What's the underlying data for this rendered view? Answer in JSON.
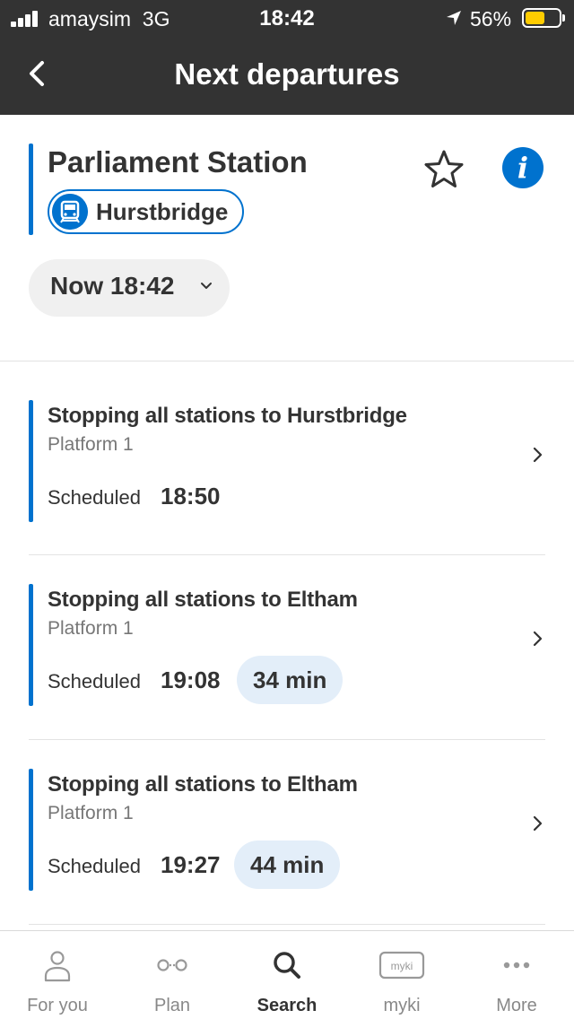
{
  "status_bar": {
    "carrier": "amaysim",
    "network": "3G",
    "time": "18:42",
    "battery": "56%",
    "battery_level": 0.56
  },
  "nav": {
    "title": "Next departures",
    "back_icon": "chevron-left-icon"
  },
  "station": {
    "name": "Parliament Station",
    "route": "Hurstbridge",
    "route_icon": "train-icon",
    "favorite_icon": "star-outline-icon",
    "info_icon": "info-icon",
    "info_glyph": "i"
  },
  "time_selector": {
    "label": "Now 18:42",
    "icon": "chevron-down-icon"
  },
  "departures": [
    {
      "destination": "Stopping all stations to Hurstbridge",
      "platform": "Platform 1",
      "scheduled_label": "Scheduled",
      "time": "18:50",
      "minutes": ""
    },
    {
      "destination": "Stopping all stations to Eltham",
      "platform": "Platform 1",
      "scheduled_label": "Scheduled",
      "time": "19:08",
      "minutes": "34 min"
    },
    {
      "destination": "Stopping all stations to Eltham",
      "platform": "Platform 1",
      "scheduled_label": "Scheduled",
      "time": "19:27",
      "minutes": "44 min"
    }
  ],
  "tabs": [
    {
      "label": "For you",
      "icon": "person-icon",
      "active": false
    },
    {
      "label": "Plan",
      "icon": "route-icon",
      "active": false
    },
    {
      "label": "Search",
      "icon": "search-icon",
      "active": true
    },
    {
      "label": "myki",
      "icon": "myki-card-icon",
      "icon_text": "myki",
      "active": false
    },
    {
      "label": "More",
      "icon": "more-icon",
      "active": false
    }
  ],
  "colors": {
    "header_bg": "#333333",
    "accent": "#0072ce",
    "battery_fill": "#ffcc00",
    "minutes_badge_bg": "#e3eef9"
  }
}
